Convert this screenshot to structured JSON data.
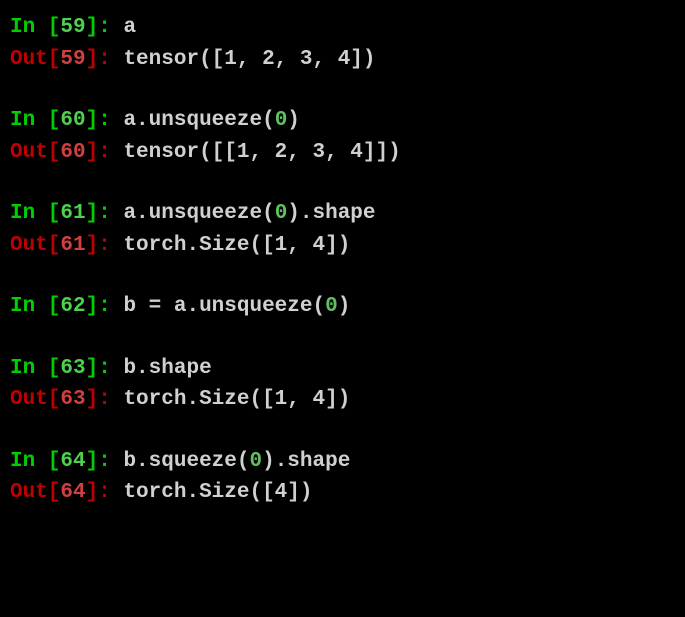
{
  "cells": [
    {
      "num": "59",
      "input_prefix": "In [",
      "input_suffix": "]: ",
      "output_prefix": "Out[",
      "output_suffix": "]: ",
      "input": "a",
      "output": "tensor([1, 2, 3, 4])",
      "has_output": true
    },
    {
      "num": "60",
      "input_prefix": "In [",
      "input_suffix": "]: ",
      "output_prefix": "Out[",
      "output_suffix": "]: ",
      "input_pre": "a.unsqueeze(",
      "input_arg": "0",
      "input_post": ")",
      "output": "tensor([[1, 2, 3, 4]])",
      "has_output": true,
      "has_arg": true
    },
    {
      "num": "61",
      "input_prefix": "In [",
      "input_suffix": "]: ",
      "output_prefix": "Out[",
      "output_suffix": "]: ",
      "input_pre": "a.unsqueeze(",
      "input_arg": "0",
      "input_post": ").shape",
      "output": "torch.Size([1, 4])",
      "has_output": true,
      "has_arg": true
    },
    {
      "num": "62",
      "input_prefix": "In [",
      "input_suffix": "]: ",
      "input_pre": "b = a.unsqueeze(",
      "input_arg": "0",
      "input_post": ")",
      "has_output": false,
      "has_arg": true
    },
    {
      "num": "63",
      "input_prefix": "In [",
      "input_suffix": "]: ",
      "output_prefix": "Out[",
      "output_suffix": "]: ",
      "input": "b.shape",
      "output": "torch.Size([1, 4])",
      "has_output": true
    },
    {
      "num": "64",
      "input_prefix": "In [",
      "input_suffix": "]: ",
      "output_prefix": "Out[",
      "output_suffix": "]: ",
      "input_pre": "b.squeeze(",
      "input_arg": "0",
      "input_post": ").shape",
      "output": "torch.Size([4])",
      "has_output": true,
      "has_arg": true
    }
  ]
}
